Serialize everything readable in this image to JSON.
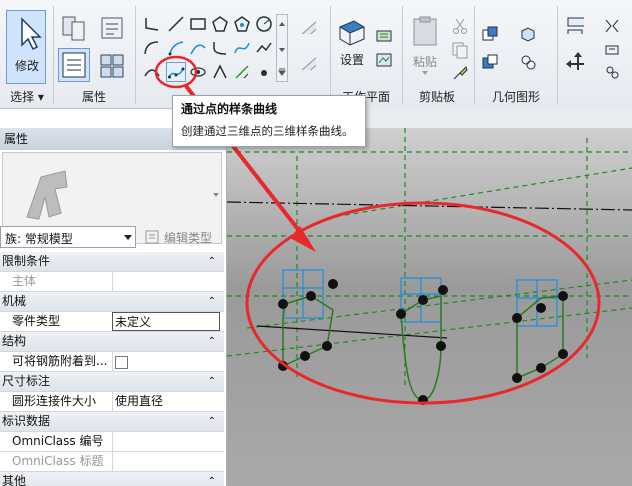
{
  "ribbon": {
    "modify_label": "修改",
    "settings_label": "设置",
    "paste_label": "粘贴",
    "groups": {
      "select": "选择 ▾",
      "properties": "属性",
      "work_plane": "工作平面",
      "clipboard": "剪贴板",
      "geometry": "几何图形"
    }
  },
  "tooltip": {
    "title": "通过点的样条曲线",
    "description": "创建通过三维点的三维样条曲线。"
  },
  "properties_panel": {
    "title": "属性",
    "type_selector": "族: 常规模型",
    "edit_type_label": "编辑类型",
    "rows": [
      {
        "kind": "category",
        "name": "限制条件"
      },
      {
        "kind": "prop",
        "name": "主体",
        "value": "",
        "disabled": true
      },
      {
        "kind": "category",
        "name": "机械"
      },
      {
        "kind": "prop",
        "name": "零件类型",
        "value": "未定义"
      },
      {
        "kind": "category",
        "name": "结构"
      },
      {
        "kind": "prop",
        "name": "可将钢筋附着到...",
        "value": ""
      },
      {
        "kind": "category",
        "name": "尺寸标注"
      },
      {
        "kind": "prop",
        "name": "圆形连接件大小",
        "value": "使用直径"
      },
      {
        "kind": "category",
        "name": "标识数据"
      },
      {
        "kind": "prop",
        "name": "OmniClass 编号",
        "value": ""
      },
      {
        "kind": "prop",
        "name": "OmniClass 标题",
        "value": "",
        "disabled": true
      },
      {
        "kind": "category",
        "name": "其他"
      }
    ]
  },
  "icons": {
    "modify": "cursor-arrow-icon",
    "spline_through_points": "spline-through-points-icon",
    "settings": "work-plane-settings-icon",
    "paste": "clipboard-paste-icon",
    "move": "move-arrows-icon"
  },
  "colors": {
    "highlight_red": "#e8282a",
    "grid_green": "#1f8a1f",
    "ref_blue": "#1a8fe0",
    "ribbon_active": "#cfe3fb"
  }
}
